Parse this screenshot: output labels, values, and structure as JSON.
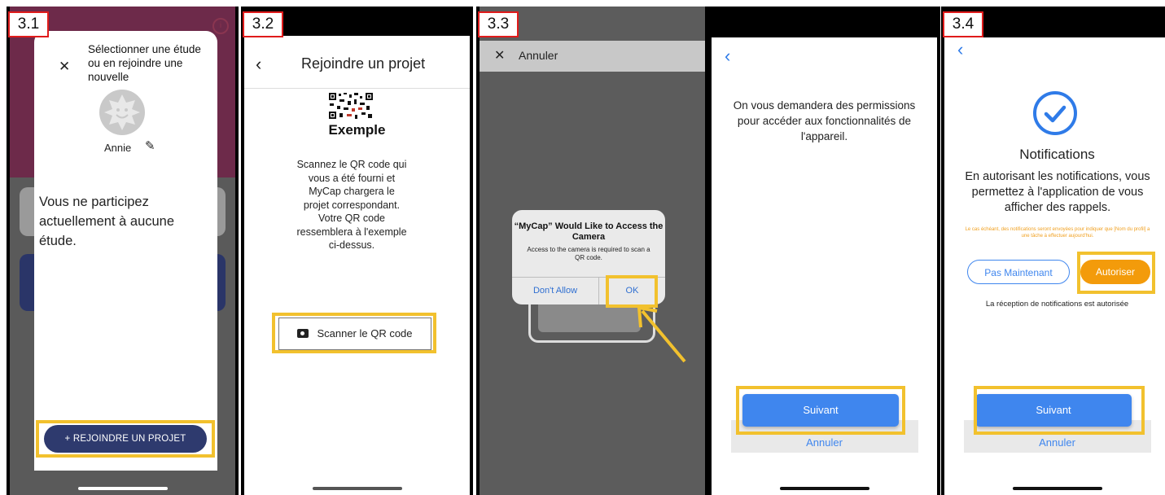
{
  "steps": [
    "3.1",
    "3.2",
    "3.3",
    "3.4"
  ],
  "screen1": {
    "title": "Sélectionner une étude ou en rejoindre une nouvelle",
    "user_name": "Annie",
    "empty_message": "Vous ne participez actuellement à aucune étude.",
    "join_button": "+   REJOINDRE UN PROJET"
  },
  "screen2": {
    "title": "Rejoindre un projet",
    "qr_label": "Exemple",
    "instructions": "Scannez le QR code qui vous a été fourni et MyCap chargera le projet correspondant. Votre QR code ressemblera à l'exemple ci-dessus.",
    "scan_button": "Scanner le QR code"
  },
  "screen3": {
    "cancel": "Annuler",
    "alert_title": "“MyCap” Would Like to Access the Camera",
    "alert_body": "Access to the camera is required to scan a QR code.",
    "deny": "Don't Allow",
    "ok": "OK"
  },
  "screen4": {
    "message": "On vous demandera des permissions pour accéder aux fonctionnalités de l'appareil.",
    "next": "Suivant",
    "cancel": "Annuler"
  },
  "screen5": {
    "title": "Notifications",
    "description": "En autorisant les notifications, vous permettez à l'application de vous afficher des rappels.",
    "small_note": "Le cas échéant, des notifications seront envoyées pour indiquer que [Nom du profil] a une tâche à effectuer aujourd'hui.",
    "not_now": "Pas Maintenant",
    "allow": "Autoriser",
    "allowed_status": "La réception de notifications est autorisée",
    "next": "Suivant",
    "cancel": "Annuler"
  },
  "colors": {
    "highlight": "#f2c12e",
    "step_border": "#e01b1b",
    "accent_blue": "#3f86ee",
    "accent_orange": "#f39b0b",
    "navy": "#2e3a6e"
  }
}
